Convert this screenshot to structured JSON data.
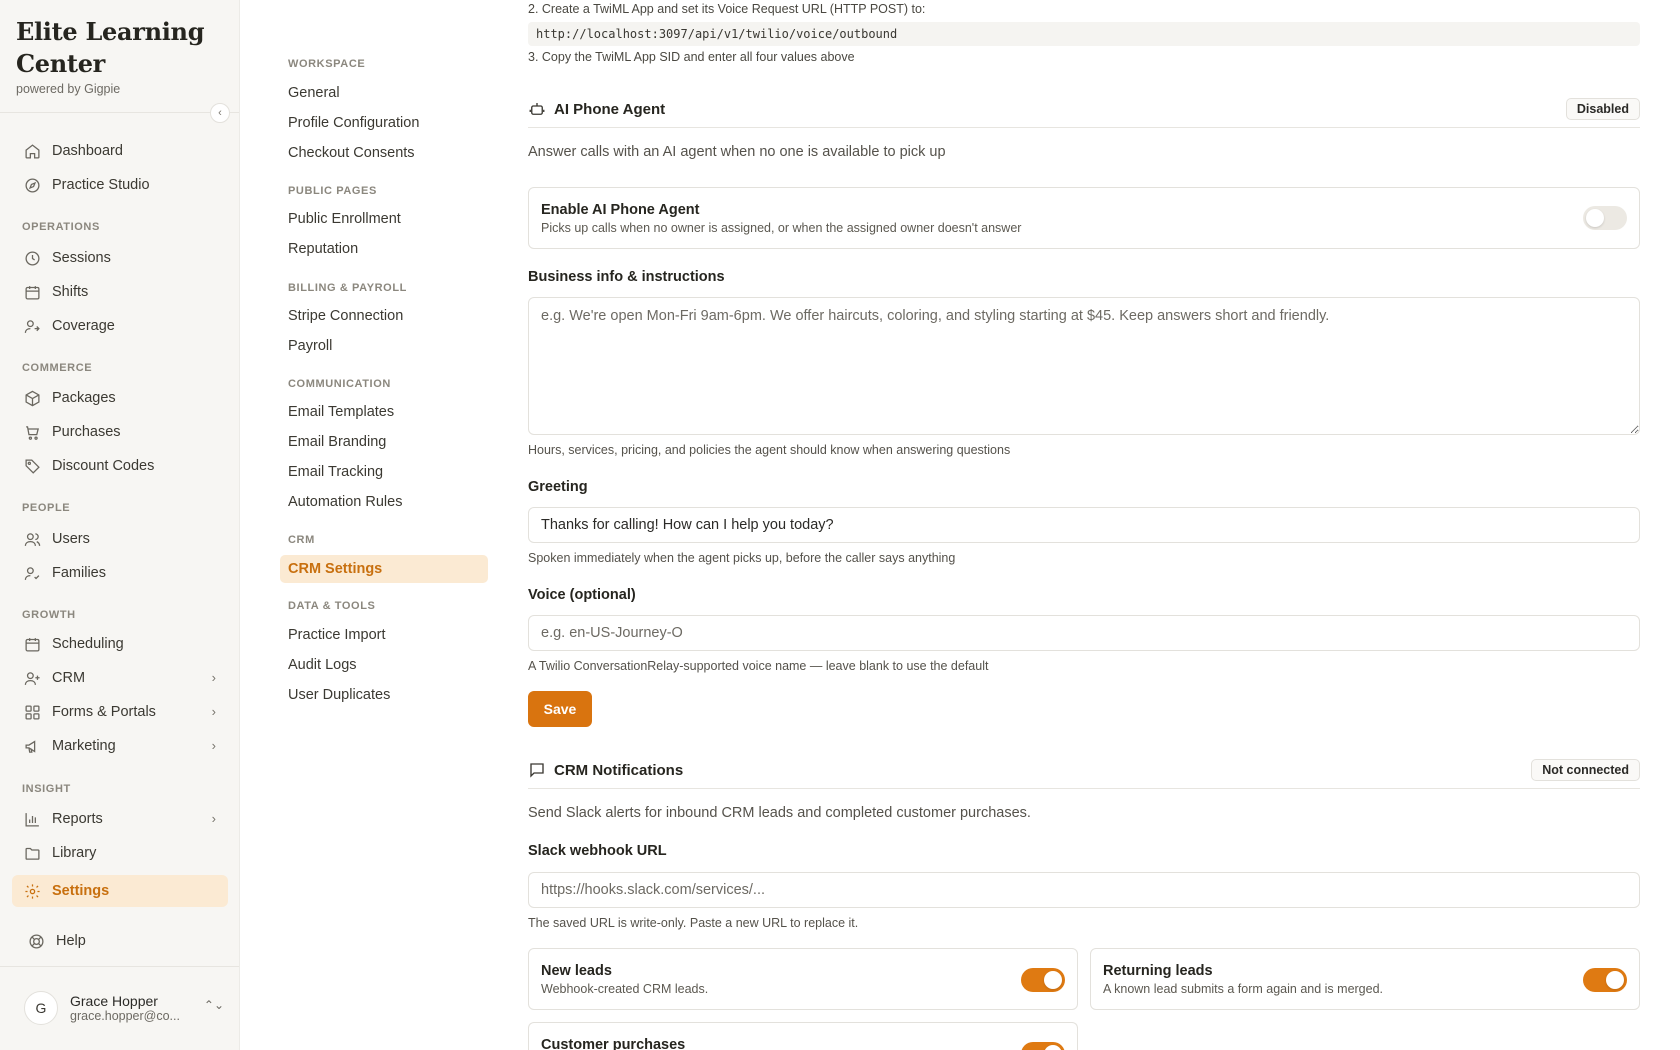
{
  "brand": {
    "title": "Elite Learning Center",
    "subtitle": "powered by Gigpie"
  },
  "sidebar": {
    "top_items": [
      {
        "label": "Dashboard",
        "icon": "home-icon"
      },
      {
        "label": "Practice Studio",
        "icon": "compass-icon"
      }
    ],
    "sections": [
      {
        "title": "OPERATIONS",
        "items": [
          {
            "label": "Sessions",
            "icon": "clock-icon"
          },
          {
            "label": "Shifts",
            "icon": "calendar-icon"
          },
          {
            "label": "Coverage",
            "icon": "user-swap-icon"
          }
        ]
      },
      {
        "title": "COMMERCE",
        "items": [
          {
            "label": "Packages",
            "icon": "package-icon"
          },
          {
            "label": "Purchases",
            "icon": "cart-icon"
          },
          {
            "label": "Discount Codes",
            "icon": "tag-icon"
          }
        ]
      },
      {
        "title": "PEOPLE",
        "items": [
          {
            "label": "Users",
            "icon": "users-icon"
          },
          {
            "label": "Families",
            "icon": "family-icon"
          }
        ]
      },
      {
        "title": "GROWTH",
        "items": [
          {
            "label": "Scheduling",
            "icon": "calendar-icon"
          },
          {
            "label": "CRM",
            "icon": "user-plus-icon"
          },
          {
            "label": "Forms & Portals",
            "icon": "grid-icon"
          },
          {
            "label": "Marketing",
            "icon": "megaphone-icon"
          }
        ]
      },
      {
        "title": "INSIGHT",
        "items": [
          {
            "label": "Reports",
            "icon": "bar-chart-icon"
          },
          {
            "label": "Library",
            "icon": "folder-icon"
          },
          {
            "label": "Settings",
            "icon": "gear-icon",
            "active": true
          }
        ]
      }
    ],
    "help_label": "Help",
    "user": {
      "initial": "G",
      "name": "Grace Hopper",
      "email": "grace.hopper@co..."
    }
  },
  "subnav": {
    "sections": [
      {
        "title": "WORKSPACE",
        "items": [
          "General",
          "Profile Configuration",
          "Checkout Consents"
        ]
      },
      {
        "title": "PUBLIC PAGES",
        "items": [
          "Public Enrollment",
          "Reputation"
        ]
      },
      {
        "title": "BILLING & PAYROLL",
        "items": [
          "Stripe Connection",
          "Payroll"
        ]
      },
      {
        "title": "COMMUNICATION",
        "items": [
          "Email Templates",
          "Email Branding",
          "Email Tracking",
          "Automation Rules"
        ]
      },
      {
        "title": "CRM",
        "items": [
          "CRM Settings"
        ]
      },
      {
        "title": "DATA & TOOLS",
        "items": [
          "Practice Import",
          "Audit Logs",
          "User Duplicates"
        ]
      }
    ],
    "active": "CRM Settings"
  },
  "twilio": {
    "step2": "2. Create a TwiML App and set its Voice Request URL (HTTP POST) to:",
    "url": "http://localhost:3097/api/v1/twilio/voice/outbound",
    "step3": "3. Copy the TwiML App SID and enter all four values above"
  },
  "ai_agent": {
    "title": "AI Phone Agent",
    "status": "Disabled",
    "description": "Answer calls with an AI agent when no one is available to pick up",
    "enable": {
      "title": "Enable AI Phone Agent",
      "subtitle": "Picks up calls when no owner is assigned, or when the assigned owner doesn't answer",
      "on": false
    },
    "business": {
      "label": "Business info & instructions",
      "placeholder": "e.g. We're open Mon-Fri 9am-6pm. We offer haircuts, coloring, and styling starting at $45. Keep answers short and friendly.",
      "help": "Hours, services, pricing, and policies the agent should know when answering questions"
    },
    "greeting": {
      "label": "Greeting",
      "value": "Thanks for calling! How can I help you today?",
      "help": "Spoken immediately when the agent picks up, before the caller says anything"
    },
    "voice": {
      "label": "Voice (optional)",
      "placeholder": "e.g. en-US-Journey-O",
      "help": "A Twilio ConversationRelay-supported voice name — leave blank to use the default"
    },
    "save_label": "Save"
  },
  "crm_notifications": {
    "title": "CRM Notifications",
    "status": "Not connected",
    "description": "Send Slack alerts for inbound CRM leads and completed customer purchases.",
    "webhook": {
      "label": "Slack webhook URL",
      "placeholder": "https://hooks.slack.com/services/...",
      "help": "The saved URL is write-only. Paste a new URL to replace it."
    },
    "toggles": [
      {
        "title": "New leads",
        "subtitle": "Webhook-created CRM leads.",
        "on": true
      },
      {
        "title": "Returning leads",
        "subtitle": "A known lead submits a form again and is merged.",
        "on": true
      },
      {
        "title": "Customer purchases",
        "subtitle": "",
        "on": true
      }
    ]
  },
  "colors": {
    "accent": "#df7a12",
    "active_bg": "#fbead3",
    "active_text": "#c8700f"
  }
}
